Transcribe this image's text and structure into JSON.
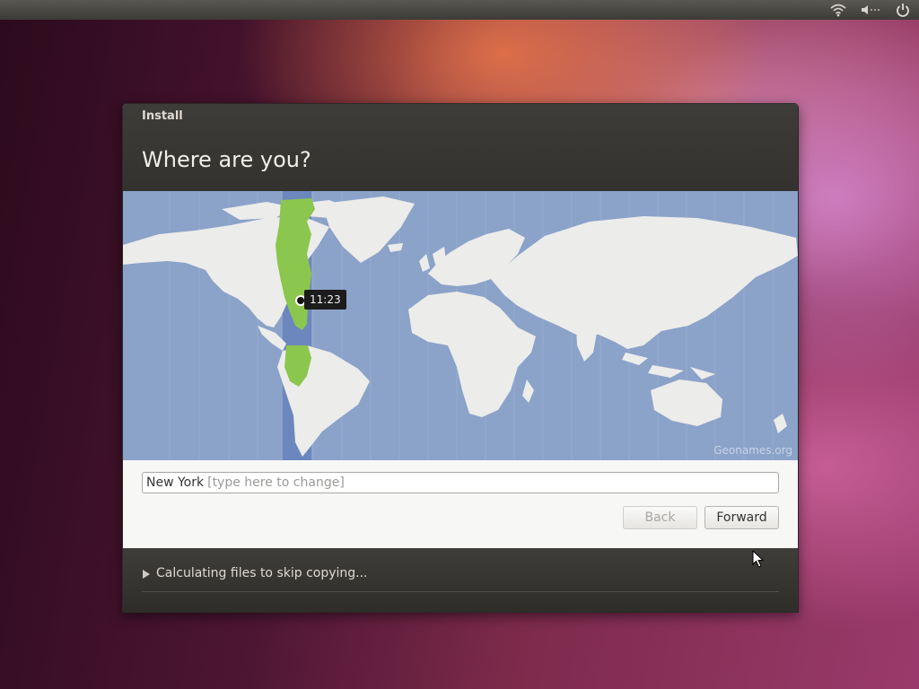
{
  "window": {
    "title": "Install",
    "heading": "Where are you?"
  },
  "map": {
    "credit": "Geonames.org",
    "time": "11:23"
  },
  "location": {
    "value": "New York",
    "hint": "[type here to change]"
  },
  "buttons": {
    "back": "Back",
    "forward": "Forward"
  },
  "progress": {
    "status": "Calculating files to skip copying..."
  },
  "colors": {
    "ocean": "#8ba2c9",
    "land": "#ececea",
    "highlight": "#8bc64e",
    "timezone_band": "#6c86be"
  }
}
